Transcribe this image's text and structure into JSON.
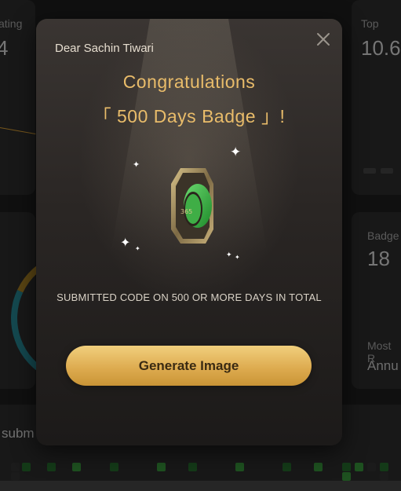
{
  "background": {
    "stats": [
      {
        "label": "ating",
        "value": "4"
      },
      {
        "label": "Top",
        "value": "10.6"
      }
    ],
    "badges_card": {
      "label": "Badge",
      "value": "18"
    },
    "most_card": {
      "label": "Most R",
      "value": "Annu"
    },
    "submissions_label": "subm"
  },
  "modal": {
    "greeting": "Dear Sachin Tiwari",
    "title_line1": "Congratulations",
    "title_line2": "「 500 Days Badge 」!",
    "badge_icon": "500-days-badge-icon",
    "description": "SUBMITTED CODE ON 500 OR MORE DAYS IN TOTAL",
    "generate_button": "Generate Image",
    "close_icon": "close-icon"
  },
  "colors": {
    "accent_gold": "#e9bc6a",
    "button_gold": "#dca94d",
    "badge_green": "#2fae3a"
  }
}
